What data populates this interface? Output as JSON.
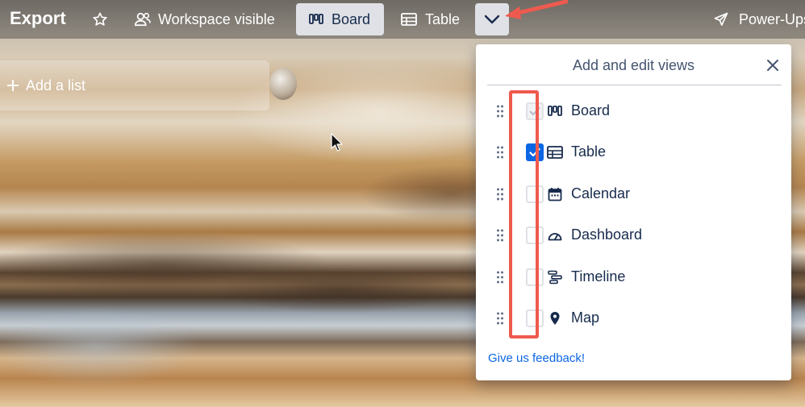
{
  "header": {
    "board_title": "Export",
    "workspace_label": "Workspace visible",
    "views": [
      {
        "label": "Board",
        "icon": "board-icon",
        "active": true
      },
      {
        "label": "Table",
        "icon": "table-icon",
        "active": false
      }
    ],
    "powerups_label": "Power-Ups"
  },
  "board": {
    "add_list_label": "Add a list"
  },
  "views_popover": {
    "title": "Add and edit views",
    "items": [
      {
        "label": "Board",
        "icon": "board-icon",
        "checked": true,
        "disabled": true
      },
      {
        "label": "Table",
        "icon": "table-icon",
        "checked": true,
        "disabled": false
      },
      {
        "label": "Calendar",
        "icon": "calendar-icon",
        "checked": false,
        "disabled": false
      },
      {
        "label": "Dashboard",
        "icon": "dashboard-icon",
        "checked": false,
        "disabled": false
      },
      {
        "label": "Timeline",
        "icon": "timeline-icon",
        "checked": false,
        "disabled": false
      },
      {
        "label": "Map",
        "icon": "map-pin-icon",
        "checked": false,
        "disabled": false
      }
    ],
    "feedback_link": "Give us feedback!"
  },
  "colors": {
    "accent": "#0c66e4",
    "annotation": "#ef5a4e",
    "active_view_bg": "#dfe1e6",
    "text_dark": "#172b4d"
  }
}
